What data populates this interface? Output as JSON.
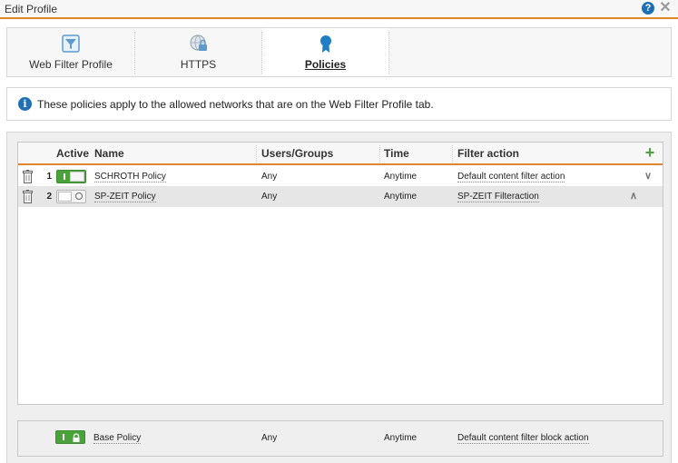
{
  "window": {
    "title": "Edit Profile",
    "help_icon": "?",
    "close_icon": "✕"
  },
  "tabs": [
    {
      "label": "Web Filter Profile",
      "icon": "filter-icon",
      "active": false
    },
    {
      "label": "HTTPS",
      "icon": "globe-lock-icon",
      "active": false
    },
    {
      "label": "Policies",
      "icon": "ribbon-icon",
      "active": true
    }
  ],
  "info": {
    "text": "These policies apply to the allowed networks that are on the Web Filter Profile tab."
  },
  "table": {
    "headers": {
      "active": "Active",
      "name": "Name",
      "users": "Users/Groups",
      "time": "Time",
      "filter": "Filter action"
    },
    "add_icon": "+",
    "rows": [
      {
        "num": "1",
        "active": true,
        "name": "SCHROTH Policy",
        "users": "Any",
        "time": "Anytime",
        "filter": "Default content filter action",
        "move": "down"
      },
      {
        "num": "2",
        "active": false,
        "name": "SP-ZEIT Policy",
        "users": "Any",
        "time": "Anytime",
        "filter": "SP-ZEIT Filteraction",
        "move": "up"
      }
    ]
  },
  "base_policy": {
    "name": "Base Policy",
    "users": "Any",
    "time": "Anytime",
    "filter": "Default content filter block action",
    "locked": true
  },
  "colors": {
    "accent": "#e0862e",
    "toggle_on": "#4aa33a",
    "info": "#1f6fb5"
  }
}
